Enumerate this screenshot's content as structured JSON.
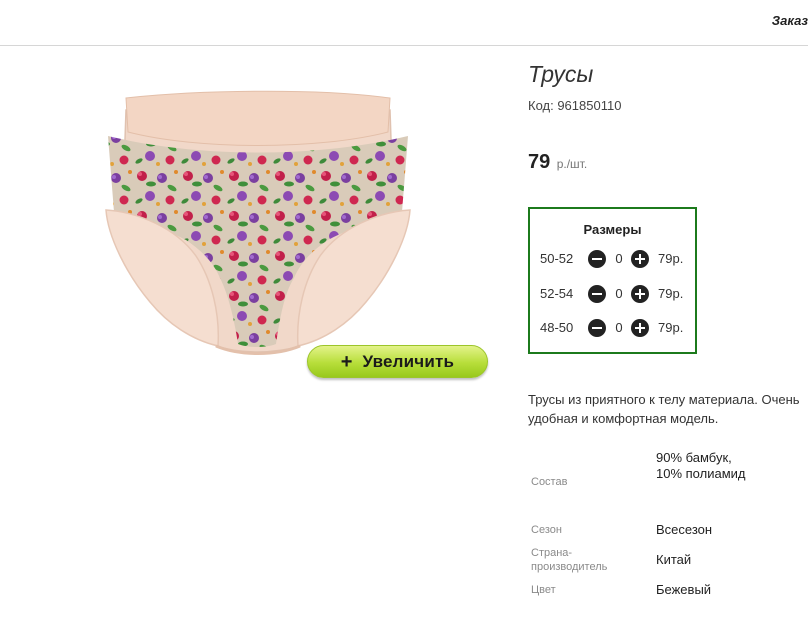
{
  "header": {
    "order_link": "Заказ"
  },
  "product": {
    "title": "Трусы",
    "code": "Код: 961850110",
    "price_value": "79",
    "price_unit": "р./шт.",
    "zoom_label": "Увеличить",
    "zoom_icon": "+",
    "sizes_title": "Размеры",
    "sizes": [
      {
        "label": "50-52",
        "qty": "0",
        "price": "79р."
      },
      {
        "label": "52-54",
        "qty": "0",
        "price": "79р."
      },
      {
        "label": "48-50",
        "qty": "0",
        "price": "79р."
      }
    ],
    "description_line1": "Трусы из приятного к телу материала. Очень",
    "description_line2": "удобная и комфортная модель.",
    "attributes": [
      {
        "label": "Состав",
        "value": "90% бамбук, 10% полиамид"
      },
      {
        "label": "Сезон",
        "value": "Всесезон"
      },
      {
        "label": "Страна-производитель",
        "value": "Китай"
      },
      {
        "label": "Цвет",
        "value": "Бежевый"
      }
    ]
  },
  "icons": {
    "minus": "minus-circle-icon",
    "plus": "plus-circle-icon"
  },
  "colors": {
    "sizes_border": "#1c7a1c",
    "zoom_button": "#b7de3a"
  }
}
